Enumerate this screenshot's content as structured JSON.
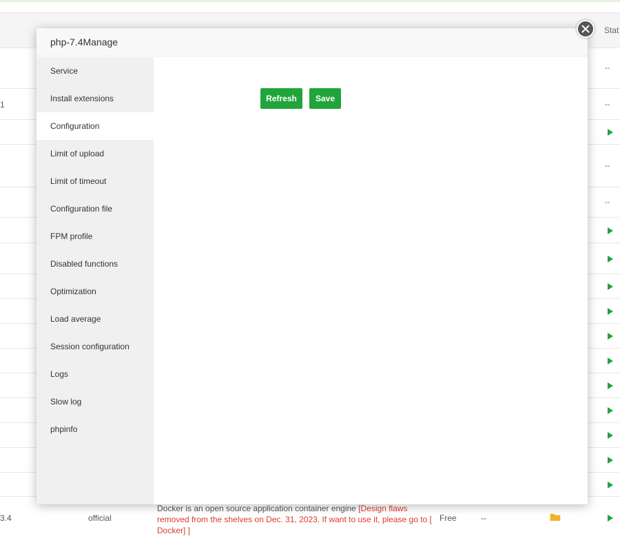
{
  "background": {
    "table_header": {
      "status_label": "Stat"
    },
    "rows": [
      {
        "left_text": "",
        "status": "--"
      },
      {
        "left_text": "1",
        "status": "--"
      },
      {
        "left_text": "",
        "status": "play"
      },
      {
        "left_text": "",
        "status": "--"
      },
      {
        "left_text": "",
        "status": "--"
      },
      {
        "left_text": "",
        "status": "play"
      },
      {
        "left_text": "",
        "status": "play"
      },
      {
        "left_text": "",
        "status": "play"
      },
      {
        "left_text": "",
        "status": "play"
      },
      {
        "left_text": "",
        "status": "play"
      },
      {
        "left_text": "",
        "status": "play"
      },
      {
        "left_text": "",
        "status": "play"
      },
      {
        "left_text": "",
        "status": "play"
      },
      {
        "left_text": "",
        "status": "play"
      },
      {
        "left_text": "",
        "status": "play"
      },
      {
        "left_text": "",
        "status": "play"
      }
    ],
    "last_row": {
      "version": "3.4",
      "type": "official",
      "description": "Docker is an open source application container engine ",
      "warning": "[Design flaws removed from the shelves on Dec. 31, 2023. If want to use it, please go to [ Docker] ]",
      "price": "Free",
      "expire": "--"
    }
  },
  "modal": {
    "title": "php-7.4Manage",
    "menu": [
      {
        "label": "Service",
        "active": false
      },
      {
        "label": "Install extensions",
        "active": false
      },
      {
        "label": "Configuration",
        "active": true
      },
      {
        "label": "Limit of upload",
        "active": false
      },
      {
        "label": "Limit of timeout",
        "active": false
      },
      {
        "label": "Configuration file",
        "active": false
      },
      {
        "label": "FPM profile",
        "active": false
      },
      {
        "label": "Disabled functions",
        "active": false
      },
      {
        "label": "Optimization",
        "active": false
      },
      {
        "label": "Load average",
        "active": false
      },
      {
        "label": "Session configuration",
        "active": false
      },
      {
        "label": "Logs",
        "active": false
      },
      {
        "label": "Slow log",
        "active": false
      },
      {
        "label": "phpinfo",
        "active": false
      }
    ],
    "buttons": {
      "refresh": "Refresh",
      "save": "Save"
    }
  },
  "colors": {
    "accent_green": "#20a53a",
    "warning_red": "#e0392b",
    "folder_yellow": "#f0b429"
  },
  "icons": {
    "close": "close-icon",
    "status_running": "play-icon",
    "folder": "folder-icon"
  }
}
